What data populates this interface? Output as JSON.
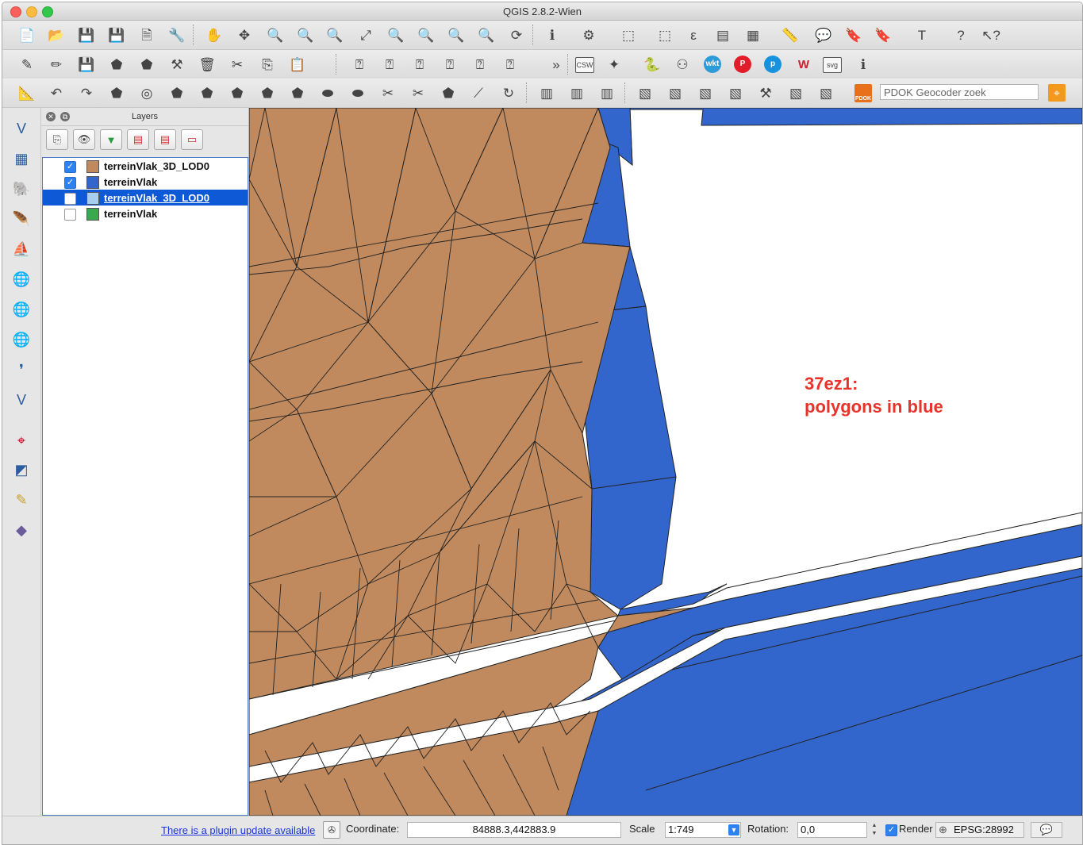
{
  "window": {
    "title": "QGIS 2.8.2-Wien"
  },
  "toolbar1": {
    "icons": [
      "new-project-icon",
      "open-project-icon",
      "save-project-icon",
      "save-as-icon",
      "new-print-composer-icon",
      "composer-manager-icon",
      "pan-map-icon",
      "pan-to-selection-icon",
      "zoom-in-icon",
      "zoom-out-icon",
      "zoom-actual-icon",
      "zoom-full-icon",
      "zoom-to-selection-icon",
      "zoom-to-layer-icon",
      "zoom-last-icon",
      "zoom-next-icon",
      "refresh-icon",
      "identify-icon",
      "run-feature-action-icon",
      "select-features-icon",
      "deselect-icon",
      "field-calculator-icon",
      "attribute-table-icon",
      "statistics-icon",
      "measure-icon",
      "map-tips-icon",
      "new-bookmark-icon",
      "show-bookmarks-icon",
      "text-annotation-icon",
      "help-icon",
      "whats-this-icon"
    ]
  },
  "toolbar2": {
    "icons": [
      "current-edits-icon",
      "toggle-editing-icon",
      "save-edits-icon",
      "add-feature-icon",
      "move-feature-icon",
      "node-tool-icon",
      "delete-selected-icon",
      "cut-features-icon",
      "copy-features-icon",
      "paste-features-icon",
      "label-icon",
      "pin-labels-icon",
      "show-hide-labels-icon",
      "move-label-icon",
      "rotate-label-icon",
      "change-label-icon",
      "more-icon",
      "csw-icon",
      "plugin-icon",
      "python-console-icon",
      "geometry-checker-icon",
      "wkt-icon",
      "p-plugin-icon",
      "pdok-plugin-icon",
      "wkt-plugin-icon",
      "svg-icon",
      "identify-plus-icon"
    ],
    "csw": "CSW",
    "wkt": "wkt",
    "svg": "svg",
    "more": "»",
    "p1": "P",
    "p2": "p"
  },
  "toolbar3": {
    "icons": [
      "snapping-icon",
      "undo-icon",
      "redo-icon",
      "simplify-icon",
      "add-ring-icon",
      "add-part-icon",
      "fill-ring-icon",
      "delete-ring-icon",
      "delete-part-icon",
      "reshape-icon",
      "offset-curve-icon",
      "split-features-icon",
      "split-parts-icon",
      "merge-features-icon",
      "merge-attributes-icon",
      "rotate-point-icon",
      "digitizer-icon",
      "layer-one-icon",
      "layer-two-icon",
      "layer-three-icon",
      "grid-one-icon",
      "grid-two-icon",
      "grid-three-icon",
      "grid-four-icon",
      "grid-five-icon",
      "grid-six-icon",
      "grid-seven-icon",
      "pdok-icon"
    ],
    "pdok_label": "PDOK",
    "search_placeholder": "PDOK Geocoder zoek"
  },
  "sidebar": {
    "icons": [
      "add-vector-layer-icon",
      "add-raster-layer-icon",
      "add-postgis-layer-icon",
      "add-spatialite-layer-icon",
      "add-mssql-layer-icon",
      "add-wms-layer-icon",
      "add-wcs-layer-icon",
      "add-wfs-layer-icon",
      "add-delimited-text-icon",
      "new-shapefile-icon",
      "add-oracle-icon",
      "georeferencer-icon",
      "gps-icon",
      "edit-icon",
      "globe-icon"
    ]
  },
  "layers_panel": {
    "title": "Layers",
    "tool_icons": [
      "add-group-icon",
      "manage-visibility-icon",
      "filter-legend-icon",
      "expand-all-icon",
      "collapse-all-icon",
      "remove-layer-icon"
    ],
    "items": [
      {
        "name": "terreinVlak_3D_LOD0",
        "checked": true,
        "color": "#c08a5e",
        "selected": false
      },
      {
        "name": "terreinVlak",
        "checked": true,
        "color": "#3266cc",
        "selected": false
      },
      {
        "name": "terreinVlak_3D_LOD0",
        "checked": false,
        "color": "#a7cdf0",
        "selected": true
      },
      {
        "name": "terreinVlak",
        "checked": false,
        "color": "#3aa84e",
        "selected": false
      }
    ]
  },
  "map": {
    "annotation_line1": "37ez1:",
    "annotation_line2": "polygons in blue",
    "brown_fill": "#c08a5e",
    "blue_fill": "#3266cc"
  },
  "status_bar": {
    "plugin_update": "There is a plugin update available",
    "coordinate_label": "Coordinate:",
    "coordinate_value": "84888.3,442883.9",
    "scale_label": "Scale",
    "scale_value": "1:749",
    "rotation_label": "Rotation:",
    "rotation_value": "0,0",
    "render_label": "Render",
    "render_checked": true,
    "crs": "EPSG:28992"
  }
}
